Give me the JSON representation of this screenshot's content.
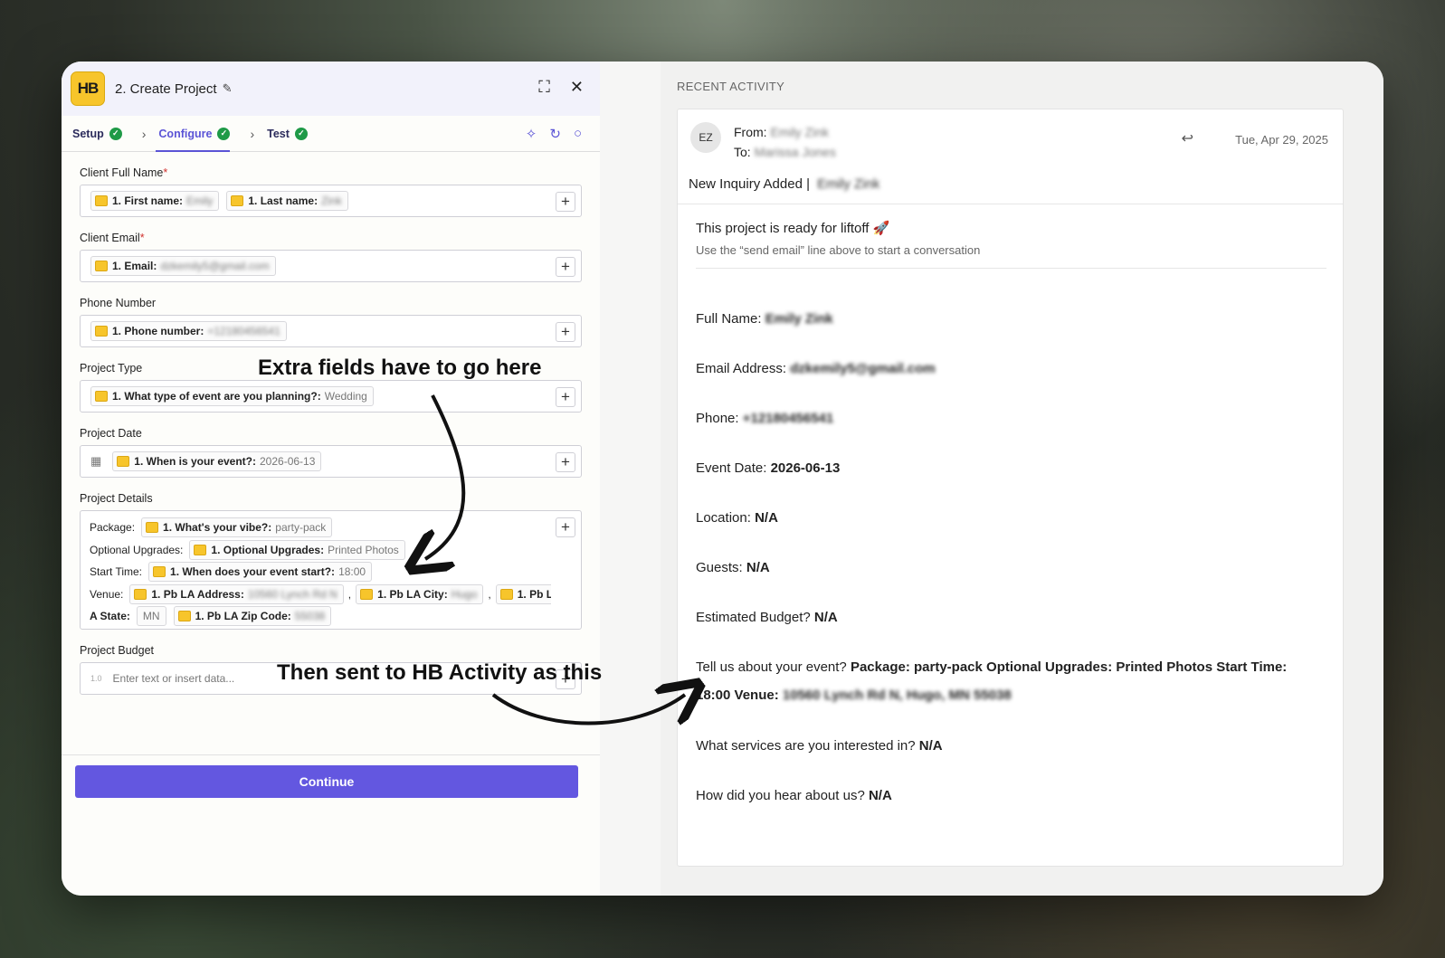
{
  "left_panel": {
    "step_title": "2. Create Project",
    "logo_text": "HB",
    "tabs": [
      {
        "label": "Setup"
      },
      {
        "label": "Configure"
      },
      {
        "label": "Test"
      }
    ],
    "fields": {
      "client_full_name": {
        "label": "Client Full Name",
        "chips": [
          {
            "label": "1. First name:",
            "value": "Emily"
          },
          {
            "label": "1. Last name:",
            "value": "Zink"
          }
        ]
      },
      "client_email": {
        "label": "Client Email",
        "chip": {
          "label": "1. Email:",
          "value": "dzkemily5@gmail.com"
        }
      },
      "phone_number": {
        "label": "Phone Number",
        "chip": {
          "label": "1. Phone number:",
          "value": "+12180456541"
        }
      },
      "project_type": {
        "label": "Project Type",
        "chip": {
          "label": "1. What type of event are you planning?:",
          "value": "Wedding"
        }
      },
      "project_date": {
        "label": "Project Date",
        "chip": {
          "label": "1. When is your event?:",
          "value": "2026-06-13"
        }
      },
      "project_details": {
        "label": "Project Details",
        "package_label": "Package:",
        "package_chip": {
          "label": "1. What's your vibe?:",
          "value": "party-pack"
        },
        "upgrades_label": "Optional Upgrades:",
        "upgrades_chip": {
          "label": "1. Optional Upgrades:",
          "value": "Printed Photos"
        },
        "start_label": "Start Time:",
        "start_chip": {
          "label": "1. When does your event start?:",
          "value": "18:00"
        },
        "venue_label": "Venue:",
        "address_chip": {
          "label": "1. Pb LA Address:",
          "value": "10560 Lynch Rd N"
        },
        "city_chip": {
          "label": "1. Pb LA City:",
          "value": "Hugo"
        },
        "state_cont_chip": {
          "label": "1. Pb L"
        },
        "state_label": "A State:",
        "state_value": "MN",
        "zip_chip": {
          "label": "1. Pb LA Zip Code:",
          "value": "55038"
        },
        "comma": ","
      },
      "project_budget": {
        "label": "Project Budget",
        "placeholder": "Enter text or insert data...",
        "icon_text": "1.0"
      }
    },
    "required_mark": "*",
    "continue_label": "Continue"
  },
  "right_panel": {
    "section_title": "RECENT ACTIVITY",
    "email": {
      "avatar": "EZ",
      "from_label": "From:",
      "from_value": "Emily Zink",
      "to_label": "To:",
      "to_value": "Marissa Jones",
      "date": "Tue, Apr 29, 2025",
      "subject": "New Inquiry Added |",
      "subject_name": "Emily Zink",
      "liftoff": "This project is ready for liftoff 🚀",
      "liftoff_sub": "Use the “send email” line above to start a conversation",
      "lines": [
        {
          "label": "Full Name:",
          "value": "Emily Zink",
          "blurred": true
        },
        {
          "label": "Email Address:",
          "value": "dzkemily5@gmail.com",
          "blurred": true
        },
        {
          "label": "Phone:",
          "value": "+12180456541",
          "blurred": true
        },
        {
          "label": "Event Date:",
          "value": "2026-06-13",
          "blurred": false
        },
        {
          "label": "Location:",
          "value": "N/A",
          "blurred": false
        },
        {
          "label": "Guests:",
          "value": "N/A",
          "blurred": false
        },
        {
          "label": "Estimated Budget?",
          "value": "N/A",
          "blurred": false
        }
      ],
      "tell_us_label": "Tell us about your event?",
      "tell_us_value": "Package: party-pack Optional Upgrades: Printed Photos Start Time: 18:00 Venue:",
      "tell_us_blurred": "10560 Lynch Rd N, Hugo, MN 55038",
      "services_label": "What services are you interested in?",
      "services_value": "N/A",
      "hear_label": "How did you hear about us?",
      "hear_value": "N/A"
    }
  },
  "annotations": {
    "top": "Extra fields have to go here",
    "bottom": "Then sent to HB Activity as this"
  }
}
